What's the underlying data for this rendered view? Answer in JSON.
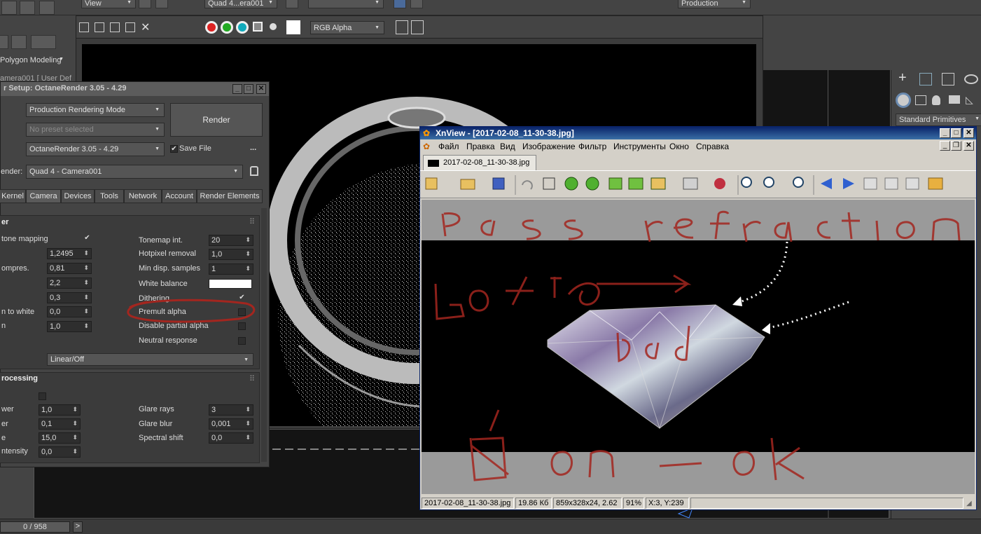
{
  "max": {
    "view_dropdown": "View",
    "viewport_dropdown": "Quad 4...era001",
    "production_dropdown": "Production",
    "polygon_modeling": "Polygon Modeling",
    "rgb_alpha": "RGB Alpha",
    "viewport_label": "amera001 [ User Def",
    "standard_primitives": "Standard Primitives",
    "timeline": "0 / 958",
    "timeline_arrow": ">"
  },
  "render_setup": {
    "title": "r Setup: OctaneRender 3.05 - 4.29",
    "mode": "Production Rendering Mode",
    "preset": "No preset selected",
    "renderer": "OctaneRender 3.05 - 4.29",
    "render_button": "Render",
    "save_file": "Save File",
    "save_check": "✔",
    "more": "...",
    "view_label": "ender:",
    "view_value": "Quad 4 - Camera001",
    "tabs": [
      {
        "label": "Kernel"
      },
      {
        "label": "Camera"
      },
      {
        "label": "Devices"
      },
      {
        "label": "Tools"
      },
      {
        "label": "Network"
      },
      {
        "label": "Account"
      },
      {
        "label": "Render Elements"
      }
    ],
    "section1_title": "er",
    "section1_close": "⠿",
    "left_rows": [
      {
        "label": "tone mapping",
        "value": "",
        "check": "✔"
      },
      {
        "label": "",
        "value": "1,2495"
      },
      {
        "label": "ompres.",
        "value": "0,81"
      },
      {
        "label": "",
        "value": "2,2"
      },
      {
        "label": "",
        "value": "0,3"
      },
      {
        "label": "n to white",
        "value": "0,0"
      },
      {
        "label": "n",
        "value": "1,0"
      }
    ],
    "right_rows": [
      {
        "label": "Tonemap int.",
        "value": "20"
      },
      {
        "label": "Hotpixel removal",
        "value": "1,0"
      },
      {
        "label": "Min disp. samples",
        "value": "1"
      },
      {
        "label": "White balance",
        "value": ""
      },
      {
        "label": "Dithering",
        "value": "",
        "check": "✔"
      },
      {
        "label": "Premult alpha",
        "value": ""
      },
      {
        "label": "Disable partial alpha",
        "value": ""
      },
      {
        "label": "Neutral response",
        "value": ""
      }
    ],
    "response": "Linear/Off",
    "section2_title": "rocessing",
    "section2_close": "⠿",
    "post_left": [
      {
        "label": "wer",
        "value": "1,0"
      },
      {
        "label": "er",
        "value": "0,1"
      },
      {
        "label": "e",
        "value": "15,0"
      },
      {
        "label": "ntensity",
        "value": "0,0"
      }
    ],
    "post_right": [
      {
        "label": "Glare rays",
        "value": "3"
      },
      {
        "label": "Glare blur",
        "value": "0,001"
      },
      {
        "label": "Spectral shift",
        "value": "0,0"
      }
    ]
  },
  "xnview": {
    "title": "XnView - [2017-02-08_11-30-38.jpg]",
    "menu": [
      "Файл",
      "Правка",
      "Вид",
      "Изображение",
      "Фильтр",
      "Инструменты",
      "Окно",
      "Справка"
    ],
    "tab_label": "2017-02-08_11-30-38.jpg",
    "status": {
      "filename": "2017-02-08_11-30-38.jpg",
      "filesize": "19.86 Кб",
      "dimensions": "859x328x24, 2.62",
      "zoom": "91%",
      "coords": "X:3, Y:239"
    }
  },
  "colors": {
    "annotation_red": "#a3261f",
    "xn_title": "#0a246a",
    "max_bg": "#444444"
  }
}
